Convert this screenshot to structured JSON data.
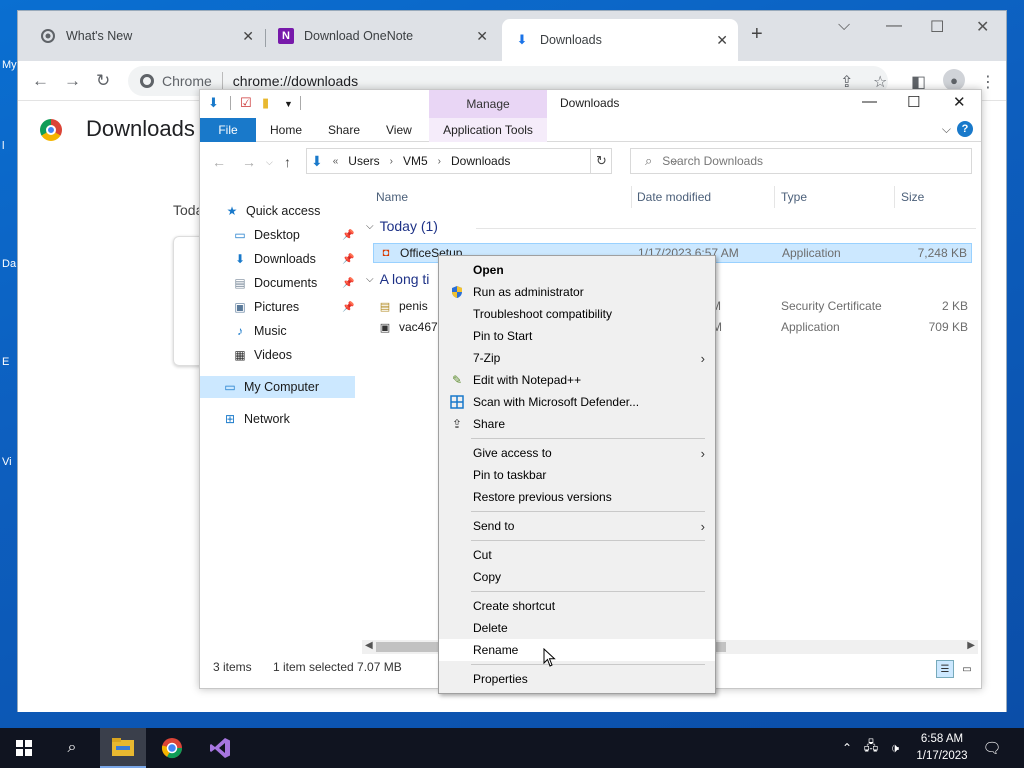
{
  "desktop": {
    "labels": [
      "My",
      "l",
      "Da",
      "E",
      "Vi"
    ]
  },
  "chrome": {
    "tabs": [
      {
        "label": "What's New"
      },
      {
        "label": "Download OneNote"
      },
      {
        "label": "Downloads"
      }
    ],
    "new_tab": "+",
    "omnibox": {
      "chip": "Chrome",
      "url": "chrome://downloads"
    },
    "page": {
      "title": "Downloads",
      "today": "Toda"
    }
  },
  "explorer": {
    "ribbon_context": "Manage",
    "window_title": "Downloads",
    "tabs": {
      "file": "File",
      "home": "Home",
      "share": "Share",
      "view": "View",
      "app_tools": "Application Tools"
    },
    "breadcrumb": {
      "lead": "«",
      "items": [
        "Users",
        "VM5",
        "Downloads"
      ]
    },
    "search_placeholder": "Search Downloads",
    "nav": [
      {
        "label": "Quick access"
      },
      {
        "label": "Desktop"
      },
      {
        "label": "Downloads"
      },
      {
        "label": "Documents"
      },
      {
        "label": "Pictures"
      },
      {
        "label": "Music"
      },
      {
        "label": "Videos"
      },
      {
        "label": "My Computer"
      },
      {
        "label": "Network"
      }
    ],
    "columns": {
      "name": "Name",
      "date": "Date modified",
      "type": "Type",
      "size": "Size"
    },
    "groups": [
      {
        "label": "Today (1)"
      },
      {
        "label": "A long ti"
      }
    ],
    "files": [
      {
        "name": "OfficeSetup",
        "date": "1/17/2023 6:57 AM",
        "type": "Application",
        "size": "7,248 KB"
      },
      {
        "name": "penis",
        "date": "3 PM",
        "type": "Security Certificate",
        "size": "2 KB"
      },
      {
        "name": "vac467",
        "date": "AM",
        "type": "Application",
        "size": "709 KB"
      }
    ],
    "status": {
      "count": "3 items",
      "selection": "1 item selected  7.07 MB"
    }
  },
  "context_menu": {
    "items": [
      {
        "label": "Open"
      },
      {
        "label": "Run as administrator"
      },
      {
        "label": "Troubleshoot compatibility"
      },
      {
        "label": "Pin to Start"
      },
      {
        "label": "7-Zip"
      },
      {
        "label": "Edit with Notepad++"
      },
      {
        "label": "Scan with Microsoft Defender..."
      },
      {
        "label": "Share"
      },
      {
        "label": "Give access to"
      },
      {
        "label": "Pin to taskbar"
      },
      {
        "label": "Restore previous versions"
      },
      {
        "label": "Send to"
      },
      {
        "label": "Cut"
      },
      {
        "label": "Copy"
      },
      {
        "label": "Create shortcut"
      },
      {
        "label": "Delete"
      },
      {
        "label": "Rename"
      },
      {
        "label": "Properties"
      }
    ]
  },
  "taskbar": {
    "time": "6:58 AM",
    "date": "1/17/2023"
  },
  "colors": {
    "accent": "#1979ca",
    "selection": "#cce8ff",
    "taskbar": "#101420",
    "manage_tab": "#e9d6f5"
  }
}
